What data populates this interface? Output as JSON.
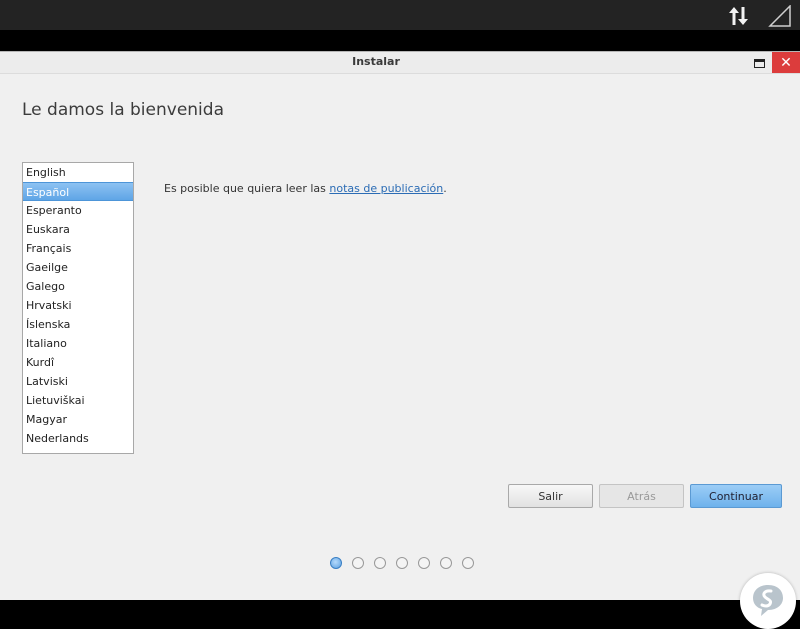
{
  "window": {
    "title": "Instalar",
    "close_glyph": "✕"
  },
  "welcome": {
    "heading": "Le damos la bienvenida"
  },
  "languages": {
    "items": [
      "English",
      "Español",
      "Esperanto",
      "Euskara",
      "Français",
      "Gaeilge",
      "Galego",
      "Hrvatski",
      "Íslenska",
      "Italiano",
      "Kurdî",
      "Latviski",
      "Lietuviškai",
      "Magyar",
      "Nederlands"
    ],
    "selected": "Español"
  },
  "release_notes": {
    "prefix": "Es posible que quiera leer las ",
    "link": "notas de publicación",
    "suffix": "."
  },
  "buttons": {
    "quit": "Salir",
    "back": "Atrás",
    "continue": "Continuar"
  },
  "steps": {
    "total": 7,
    "current": 1
  },
  "icons": {
    "network": "network-transfer-icon",
    "signal": "signal-strength-icon",
    "maximize": "maximize-icon",
    "close": "close-icon",
    "watermark": "solvetic-logo-icon"
  },
  "colors": {
    "selection": "#5fa5e6",
    "close_button": "#dc3c3c",
    "link": "#2b6cb5",
    "continue_button": "#6eb2ec"
  }
}
